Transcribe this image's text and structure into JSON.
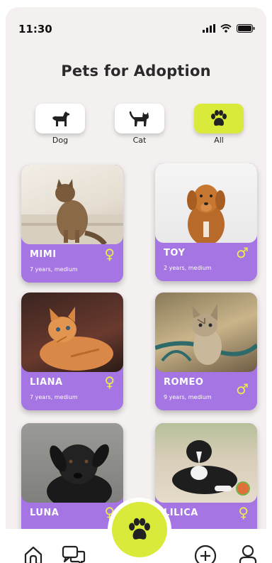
{
  "status": {
    "time": "11:30"
  },
  "title": "Pets for Adoption",
  "categories": [
    {
      "label": "Dog",
      "icon": "dog-icon",
      "active": false
    },
    {
      "label": "Cat",
      "icon": "cat-icon",
      "active": false
    },
    {
      "label": "All",
      "icon": "paw-icon",
      "active": true
    }
  ],
  "pets": [
    {
      "name": "MIMI",
      "info": "7 years, medium",
      "gender": "♀"
    },
    {
      "name": "TOY",
      "info": "2 years, medium",
      "gender": "♂"
    },
    {
      "name": "LIANA",
      "info": "7 years, medium",
      "gender": "♀"
    },
    {
      "name": "ROMEO",
      "info": "9 years, medium",
      "gender": "♂"
    },
    {
      "name": "LUNA",
      "info": "",
      "gender": "♀"
    },
    {
      "name": "LILICA",
      "info": "",
      "gender": "♀"
    }
  ],
  "colors": {
    "accent": "#d9ea3a",
    "card": "#a575e3",
    "background": "#f3f0ef"
  },
  "nav": [
    "home-icon",
    "chat-icon",
    "paw-icon",
    "add-icon",
    "profile-icon"
  ]
}
